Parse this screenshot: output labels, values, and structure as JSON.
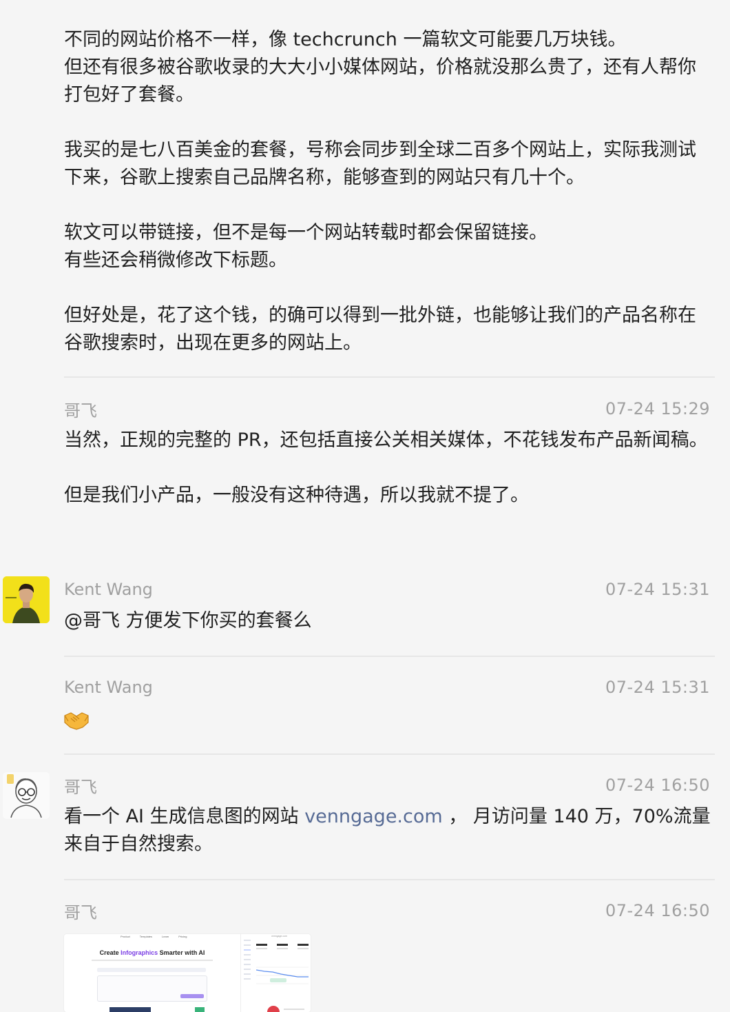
{
  "messages": [
    {
      "paragraphs": [
        "不同的网站价格不一样，像 techcrunch 一篇软文可能要几万块钱。",
        "但还有很多被谷歌收录的大大小小媒体网站，价格就没那么贵了，还有人帮你打包好了套餐。",
        "我买的是七八百美金的套餐，号称会同步到全球二百多个网站上，实际我测试下来，谷歌上搜索自己品牌名称，能够查到的网站只有几十个。",
        "软文可以带链接，但不是每一个网站转载时都会保留链接。",
        "有些还会稍微修改下标题。",
        "但好处是，花了这个钱，的确可以得到一批外链，也能够让我们的产品名称在谷歌搜索时，出现在更多的网站上。"
      ]
    },
    {
      "sender": "哥飞",
      "time": "07-24 15:29",
      "paragraphs": [
        "当然，正规的完整的 PR，还包括直接公关相关媒体，不花钱发布产品新闻稿。",
        "但是我们小产品，一般没有这种待遇，所以我就不提了。"
      ]
    },
    {
      "sender": "Kent Wang",
      "time": "07-24 15:31",
      "text": "@哥飞 方便发下你买的套餐么"
    },
    {
      "sender": "Kent Wang",
      "time": "07-24 15:31",
      "emoji": "handshake-emoji"
    },
    {
      "sender": "哥飞",
      "time": "07-24 16:50",
      "text_before": "看一个 AI 生成信息图的网站 ",
      "link": "venngage.com",
      "text_after": " ，  月访问量 140 万，70%流量来自于自然搜索。"
    },
    {
      "sender": "哥飞",
      "time": "07-24 16:50",
      "image": {
        "nav": [
          "Product",
          "Templates",
          "Learn",
          "Pricing"
        ],
        "headline_prefix": "Create ",
        "headline_accent": "Infographics",
        "headline_suffix": " Smarter with AI",
        "domain": "venngage.com"
      }
    }
  ],
  "colors": {
    "background": "#f5f5f5",
    "link": "#576b95",
    "meta": "#a0a0a0",
    "avatar_kent_bg": "#f2e01a"
  }
}
